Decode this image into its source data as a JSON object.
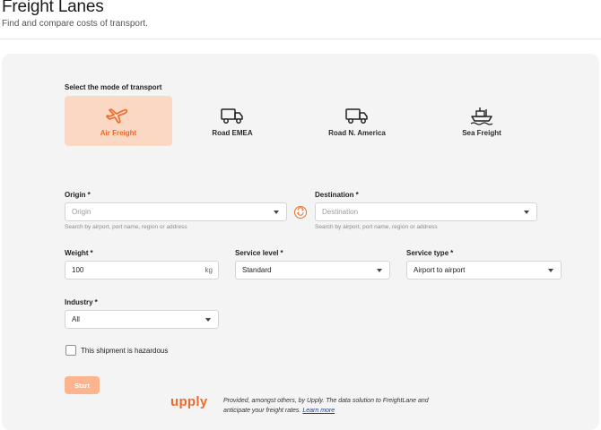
{
  "header": {
    "title": "Freight Lanes",
    "subtitle": "Find and compare costs of transport."
  },
  "transport": {
    "label": "Select the mode of transport",
    "modes": [
      {
        "label": "Air Freight",
        "icon": "airplane-icon",
        "selected": true
      },
      {
        "label": "Road EMEA",
        "icon": "truck-icon",
        "selected": false
      },
      {
        "label": "Road N. America",
        "icon": "truck-icon",
        "selected": false
      },
      {
        "label": "Sea Freight",
        "icon": "ship-icon",
        "selected": false
      }
    ]
  },
  "origin": {
    "label": "Origin",
    "required": "*",
    "placeholder": "Origin",
    "hint": "Search by airport, port name, region or address"
  },
  "destination": {
    "label": "Destination",
    "required": "*",
    "placeholder": "Destination",
    "hint": "Search by airport, port name, region or address"
  },
  "weight": {
    "label": "Weight",
    "required": "*",
    "value": "100",
    "unit": "kg"
  },
  "service_level": {
    "label": "Service level",
    "required": "*",
    "value": "Standard"
  },
  "service_type": {
    "label": "Service type",
    "required": "*",
    "value": "Airport to airport"
  },
  "industry": {
    "label": "Industry",
    "required": "*",
    "value": "All"
  },
  "hazardous": {
    "label": "This shipment is hazardous",
    "checked": false
  },
  "start_label": "Start",
  "footer": {
    "brand": "upply",
    "text": "Provided, amongst others, by Upply. The data solution to FreightLane and anticipate your freight rates.",
    "link": "Learn more"
  },
  "colors": {
    "accent": "#ee6a2c",
    "selected_bg": "#fbd8c4",
    "start_bg": "#fbb48e"
  }
}
